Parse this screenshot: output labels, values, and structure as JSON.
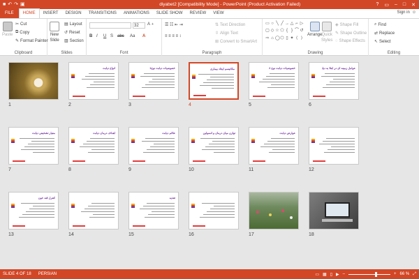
{
  "titlebar": {
    "title": "diyabet2 [Compatibility Mode] - PowerPoint (Product Activation Failed)",
    "qat": [
      "save-icon",
      "undo-icon",
      "redo-icon",
      "start-icon"
    ],
    "help": "?"
  },
  "tabs": [
    "FILE",
    "HOME",
    "INSERT",
    "DESIGN",
    "TRANSITIONS",
    "ANIMATIONS",
    "SLIDE SHOW",
    "REVIEW",
    "VIEW"
  ],
  "active_tab": "HOME",
  "signin": "Sign in",
  "ribbon": {
    "clipboard": {
      "label": "Clipboard",
      "paste": "Paste",
      "cut": "Cut",
      "copy": "Copy",
      "format_painter": "Format Painter"
    },
    "slides": {
      "label": "Slides",
      "new_slide_1": "New",
      "new_slide_2": "Slide",
      "layout": "Layout",
      "reset": "Reset",
      "section": "Section"
    },
    "font": {
      "label": "Font",
      "size": "32",
      "bold": "B",
      "italic": "I",
      "underline": "U",
      "shadow": "S",
      "strike": "abc",
      "aa": "Aa"
    },
    "paragraph": {
      "label": "Paragraph",
      "text_direction": "Text Direction",
      "align_text": "Align Text",
      "convert_smartart": "Convert to SmartArt"
    },
    "drawing": {
      "label": "Drawing",
      "arrange": "Arrange",
      "quick_styles_1": "Quick",
      "quick_styles_2": "Styles",
      "shape_fill": "Shape Fill",
      "shape_outline": "Shape Outline",
      "shape_effects": "Shape Effects"
    },
    "editing": {
      "label": "Editing",
      "find": "Find",
      "replace": "Replace",
      "select": "Select"
    }
  },
  "slides": [
    {
      "num": "1",
      "kind": "image-flower",
      "title": "دیابت"
    },
    {
      "num": "2",
      "kind": "text",
      "title": "انواع دیابت"
    },
    {
      "num": "3",
      "kind": "text",
      "title": "خصوصیات دیابت نوع1"
    },
    {
      "num": "4",
      "kind": "text",
      "title": "مکانیسم ایجاد بیماری",
      "selected": true
    },
    {
      "num": "5",
      "kind": "text",
      "title": "خصوصیات دیابت نوع 2"
    },
    {
      "num": "6",
      "kind": "text",
      "title": "عوامل زمینه ای در ابتلا به دیابت"
    },
    {
      "num": "7",
      "kind": "text",
      "title": "معیار تشخیص دیابت"
    },
    {
      "num": "8",
      "kind": "text",
      "title": "اهداف درمان دیابت"
    },
    {
      "num": "9",
      "kind": "text",
      "title": "علائم دیابت"
    },
    {
      "num": "10",
      "kind": "text",
      "title": "توازن میان درمان و انسولین"
    },
    {
      "num": "11",
      "kind": "text",
      "title": "عوارض دیابت"
    },
    {
      "num": "12",
      "kind": "text",
      "title": ""
    },
    {
      "num": "13",
      "kind": "text",
      "title": "کنترل قند خون"
    },
    {
      "num": "14",
      "kind": "text",
      "title": ""
    },
    {
      "num": "15",
      "kind": "text",
      "title": "تغذیه"
    },
    {
      "num": "16",
      "kind": "text",
      "title": ""
    },
    {
      "num": "17",
      "kind": "image-garden",
      "title": ""
    },
    {
      "num": "18",
      "kind": "image-laptop",
      "title": ""
    }
  ],
  "status": {
    "slide_of": "SLIDE 4 OF 18",
    "language": "PERSIAN",
    "zoom": "66 %",
    "zoom_level": 0.66
  },
  "colors": {
    "accent": "#d24726",
    "title_purple": "#7030a0",
    "footer_red": "#e23b3b"
  }
}
